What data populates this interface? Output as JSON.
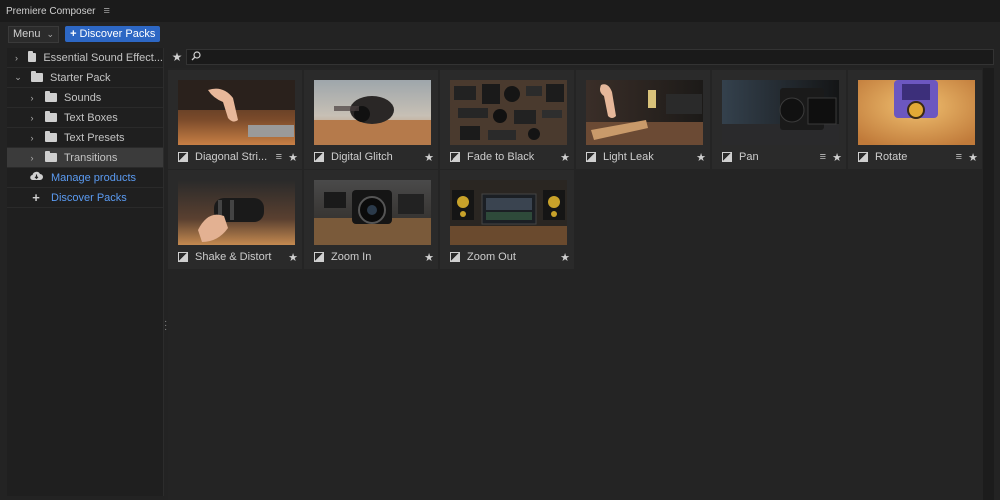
{
  "app": {
    "title": "Premiere Composer"
  },
  "toolbar": {
    "menu_label": "Menu",
    "discover_label": "Discover Packs"
  },
  "sidebar": {
    "items": [
      {
        "label": "Essential Sound Effect...",
        "arrow": "›",
        "depth": 0
      },
      {
        "label": "Starter Pack",
        "arrow": "⌄",
        "depth": 0
      },
      {
        "label": "Sounds",
        "arrow": "›",
        "depth": 1
      },
      {
        "label": "Text Boxes",
        "arrow": "›",
        "depth": 1
      },
      {
        "label": "Text Presets",
        "arrow": "›",
        "depth": 1
      },
      {
        "label": "Transitions",
        "arrow": "›",
        "depth": 1,
        "selected": true
      }
    ],
    "links": [
      {
        "label": "Manage products",
        "icon": "cloud-download-icon"
      },
      {
        "label": "Discover Packs",
        "icon": "plus-icon"
      }
    ]
  },
  "search": {
    "value": ""
  },
  "grid": {
    "items": [
      {
        "label": "Diagonal Stri...",
        "has_menu": true
      },
      {
        "label": "Digital Glitch",
        "has_menu": false
      },
      {
        "label": "Fade to Black",
        "has_menu": false
      },
      {
        "label": "Light Leak",
        "has_menu": false
      },
      {
        "label": "Pan",
        "has_menu": true
      },
      {
        "label": "Rotate",
        "has_menu": true
      },
      {
        "label": "Shake & Distort",
        "has_menu": false
      },
      {
        "label": "Zoom In",
        "has_menu": false
      },
      {
        "label": "Zoom Out",
        "has_menu": false
      }
    ]
  },
  "colors": {
    "accent": "#2d67c4",
    "link": "#5b9bf2",
    "background": "#232323"
  }
}
